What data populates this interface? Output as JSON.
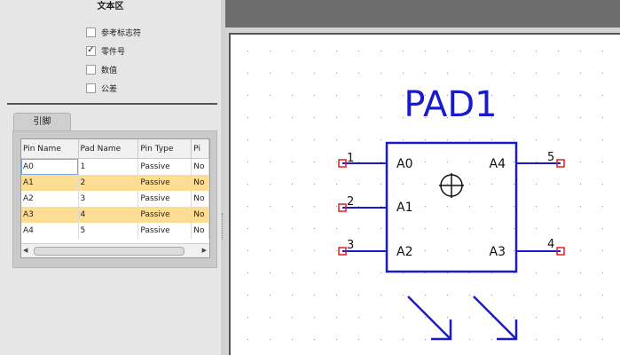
{
  "left_panel": {
    "section_title": "文本区",
    "options": [
      {
        "label": "参考标志符",
        "checked": false
      },
      {
        "label": "零件号",
        "checked": true
      },
      {
        "label": "数值",
        "checked": false
      },
      {
        "label": "公差",
        "checked": false
      }
    ],
    "tab_label": "引脚",
    "pin_table": {
      "columns": [
        "Pin Name",
        "Pad Name",
        "Pin Type",
        "Pi"
      ],
      "rows": [
        [
          "A0",
          "1",
          "Passive",
          "No"
        ],
        [
          "A1",
          "2",
          "Passive",
          "No"
        ],
        [
          "A2",
          "3",
          "Passive",
          "No"
        ],
        [
          "A3",
          "4",
          "Passive",
          "No"
        ],
        [
          "A4",
          "5",
          "Passive",
          "No"
        ]
      ]
    }
  },
  "schematic": {
    "title": "PAD1",
    "accent_color": "#1a1acc",
    "pin_marker_color": "#e02020",
    "pins_left": [
      {
        "number": "1",
        "name": "A0"
      },
      {
        "number": "2",
        "name": "A1"
      },
      {
        "number": "3",
        "name": "A2"
      }
    ],
    "pins_right": [
      {
        "number": "5",
        "name": "A4"
      },
      {
        "number": "4",
        "name": "A3"
      }
    ]
  }
}
